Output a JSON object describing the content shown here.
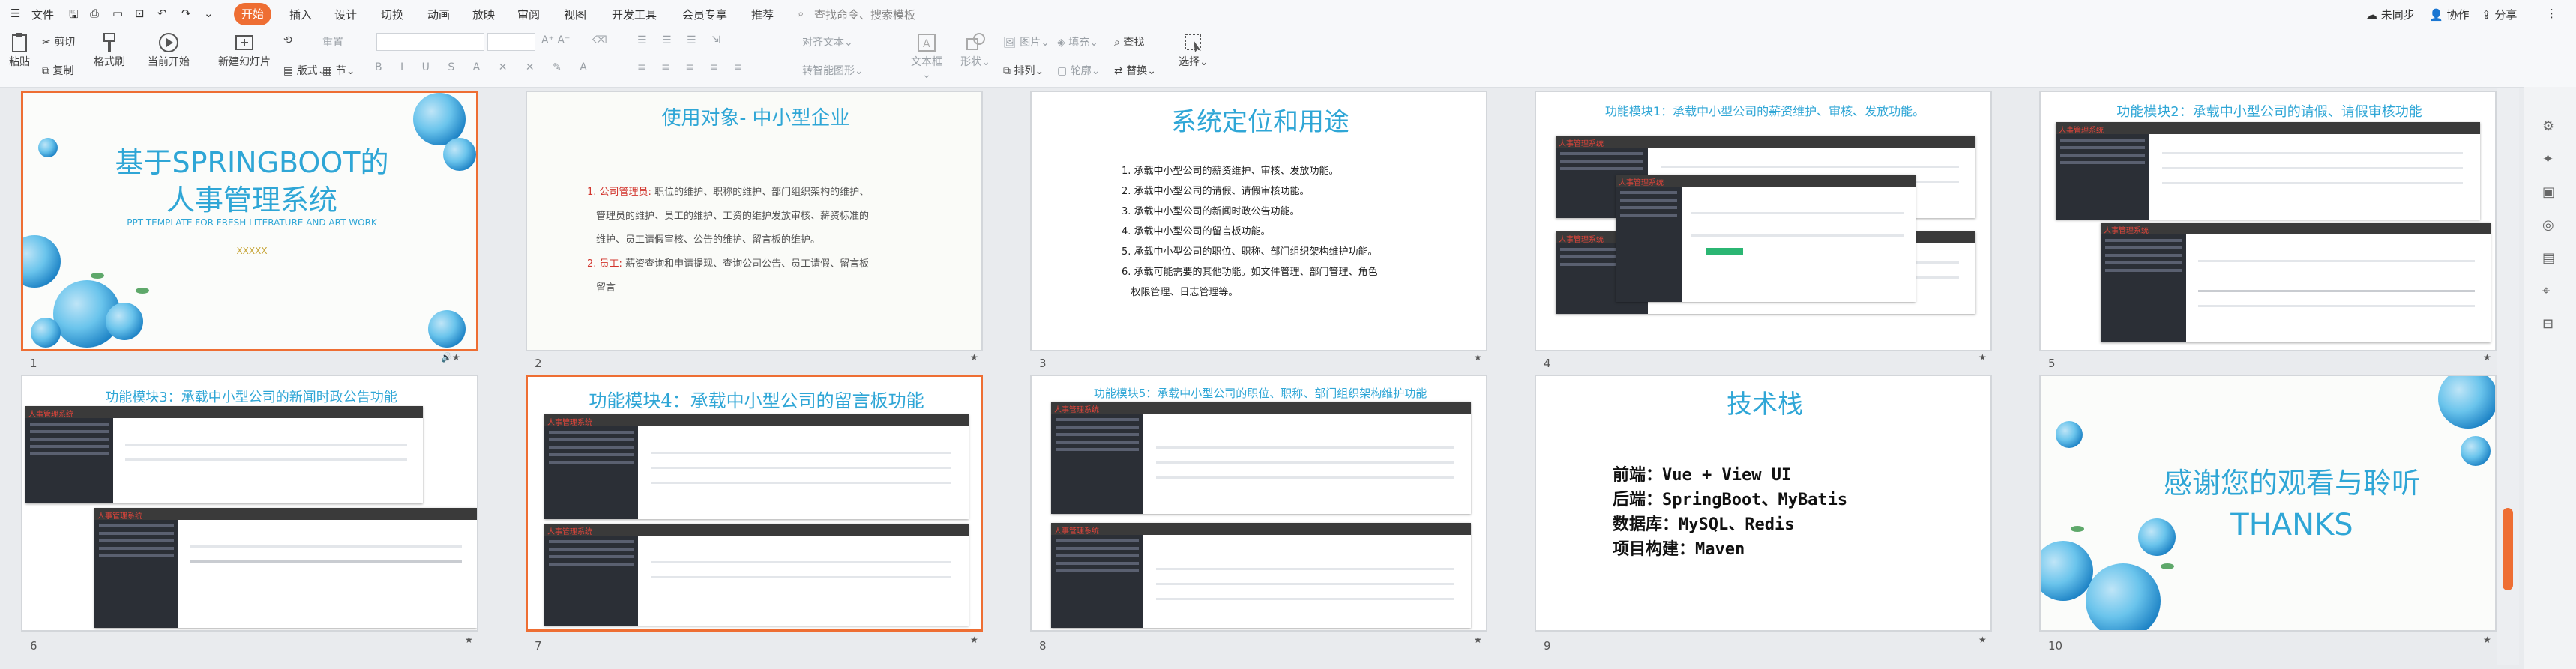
{
  "menu": {
    "file": "文件",
    "tabs": [
      "开始",
      "插入",
      "设计",
      "切换",
      "动画",
      "放映",
      "审阅",
      "视图",
      "开发工具",
      "会员专享",
      "推荐"
    ],
    "search_placeholder": "查找命令、搜索模板",
    "right": [
      "未同步",
      "协作",
      "分享"
    ]
  },
  "toolbar": {
    "paste": "粘贴",
    "cut": "剪切",
    "copy": "复制",
    "format_painter": "格式刷",
    "from_current": "当前开始",
    "new_slide": "新建幻灯片",
    "layout": "版式",
    "section": "节",
    "reset": "重置",
    "align_text": "对齐文本",
    "convert_smartart": "转智能图形",
    "textbox": "文本框",
    "shape": "形状",
    "picture": "图片",
    "fill": "填充",
    "arrange": "排列",
    "outline": "轮廓",
    "find": "查找",
    "replace": "替换",
    "select": "选择"
  },
  "slides": [
    {
      "num": "1",
      "title": "基于SPRINGBOOT的",
      "title2": "人事管理系统",
      "subtitle": "PPT TEMPLATE FOR FRESH LITERATURE AND ART WORK",
      "note": "XXXXX"
    },
    {
      "num": "2",
      "title": "使用对象- 中小型企业",
      "items": [
        {
          "idx": "1.",
          "label": "公司管理员:",
          "lines": [
            "职位的维护、职称的维护、部门组织架构的维护、",
            "管理员的维护、员工的维护、工资的维护发放审核、薪资标准的",
            "维护、员工请假审核、公告的维护、留言板的维护。"
          ]
        },
        {
          "idx": "2.",
          "label": "员工:",
          "lines": [
            "薪资查询和申请提现、查询公司公告、员工请假、留言板",
            "留言"
          ]
        }
      ]
    },
    {
      "num": "3",
      "title": "系统定位和用途",
      "items": [
        "1. 承载中小型公司的薪资维护、审核、发放功能。",
        "2. 承载中小型公司的请假、请假审核功能。",
        "3. 承载中小型公司的新闻时政公告功能。",
        "4. 承载中小型公司的留言板功能。",
        "5. 承载中小型公司的职位、职称、部门组织架构维护功能。",
        "6. 承载可能需要的其他功能。如文件管理、部门管理、角色",
        "   权限管理、日志管理等。"
      ]
    },
    {
      "num": "4",
      "title": "功能模块1：承载中小型公司的薪资维护、审核、发放功能。"
    },
    {
      "num": "5",
      "title": "功能模块2：承载中小型公司的请假、请假审核功能"
    },
    {
      "num": "6",
      "title": "功能模块3：承载中小型公司的新闻时政公告功能"
    },
    {
      "num": "7",
      "title": "功能模块4：承载中小型公司的留言板功能"
    },
    {
      "num": "8",
      "title": "功能模块5：承载中小型公司的职位、职称、部门组织架构维护功能"
    },
    {
      "num": "9",
      "title": "技术栈",
      "lines": [
        "前端：Vue + View UI",
        "后端：SpringBoot、MyBatis",
        "数据库：MySQL、Redis",
        "项目构建：Maven"
      ]
    },
    {
      "num": "10",
      "title": "感谢您的观看与聆听",
      "subtitle": "THANKS"
    }
  ],
  "colors": {
    "accent": "#ee6e33",
    "title_blue": "#2fa6d6",
    "red": "#d2342c"
  }
}
